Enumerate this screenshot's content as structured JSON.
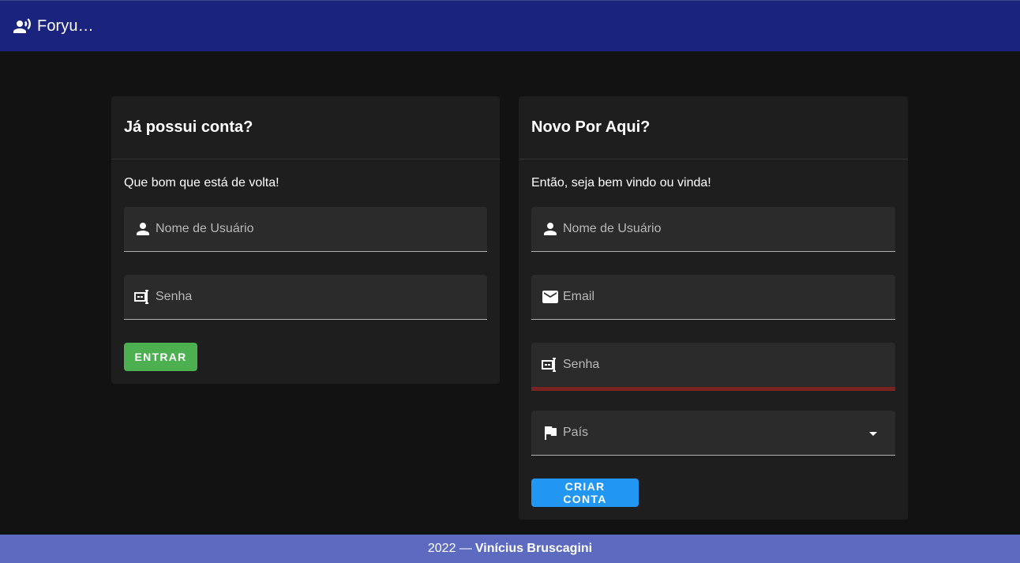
{
  "app_bar": {
    "title": "Foryu…",
    "icon": "record-voice-over-icon"
  },
  "login": {
    "title": "Já possui conta?",
    "text": "Que bom que está de volta!",
    "username_placeholder": "Nome de Usuário",
    "password_placeholder": "Senha",
    "submit_label": "ENTRAR"
  },
  "register": {
    "title": "Novo Por Aqui?",
    "text": "Então, seja bem vindo ou vinda!",
    "username_placeholder": "Nome de Usuário",
    "email_placeholder": "Email",
    "password_placeholder": "Senha",
    "country_placeholder": "País",
    "submit_label": "CRIAR CONTA"
  },
  "footer": {
    "year": "2022 —",
    "author": "Vinícius Bruscagini"
  },
  "colors": {
    "app_bar": "#1a237e",
    "background": "#121212",
    "card": "#1e1e1e",
    "field": "#2b2b2b",
    "login_button": "#4caf50",
    "register_button": "#2196f3",
    "error_underline": "#7a2421",
    "footer": "#5c6bc0"
  }
}
